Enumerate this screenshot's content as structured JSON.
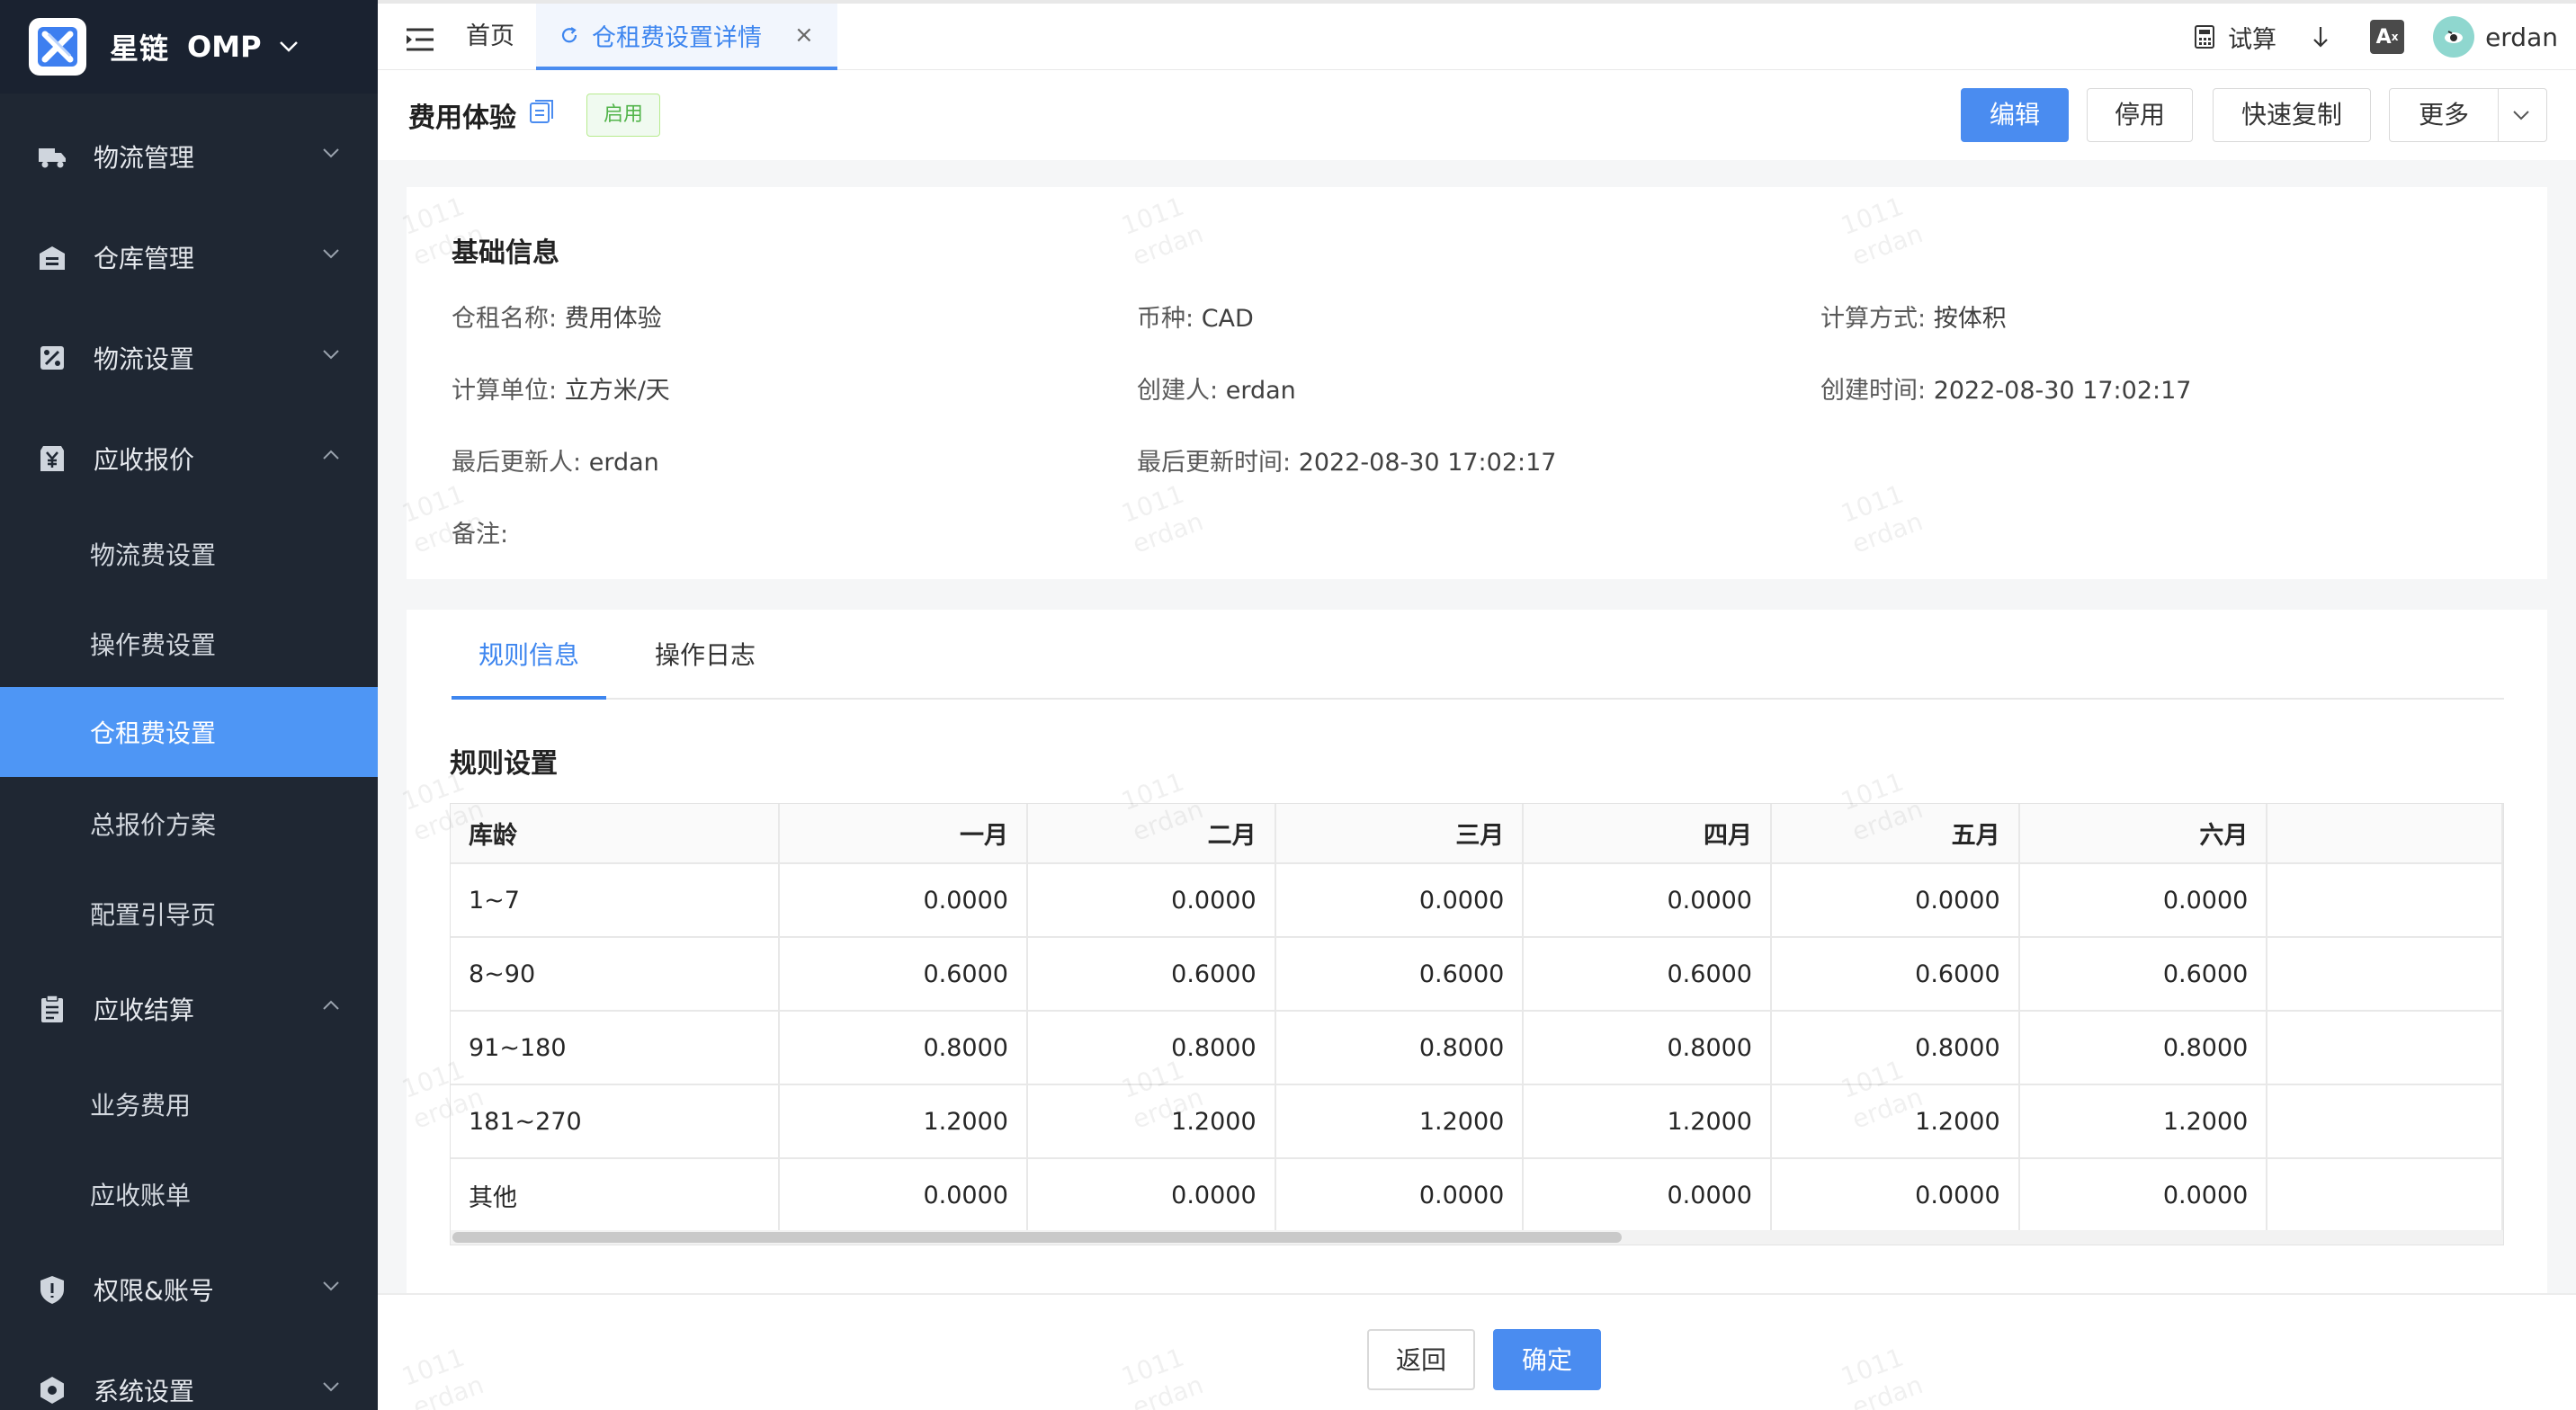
{
  "app": {
    "brand_name": "星链",
    "brand_product": "OMP"
  },
  "sidebar": {
    "items": [
      {
        "label": "物流管理",
        "icon": "truck-icon",
        "expanded": false
      },
      {
        "label": "仓库管理",
        "icon": "warehouse-icon",
        "expanded": false
      },
      {
        "label": "物流设置",
        "icon": "settings-box-icon",
        "expanded": false
      },
      {
        "label": "应收报价",
        "icon": "yen-icon",
        "expanded": true
      },
      {
        "label": "应收结算",
        "icon": "clipboard-icon",
        "expanded": true
      },
      {
        "label": "权限&账号",
        "icon": "shield-icon",
        "expanded": false
      },
      {
        "label": "系统设置",
        "icon": "hexagon-settings-icon",
        "expanded": false
      }
    ],
    "quote_children": [
      "物流费设置",
      "操作费设置",
      "仓租费设置",
      "总报价方案",
      "配置引导页"
    ],
    "settlement_children": [
      "业务费用",
      "应收账单"
    ],
    "active_child": "仓租费设置"
  },
  "topbar": {
    "home_tab": "首页",
    "active_tab": "仓租费设置详情",
    "close_symbol": "×",
    "trial_label": "试算",
    "lang_label": "A",
    "username": "erdan"
  },
  "header": {
    "title": "费用体验",
    "status": "启用",
    "buttons": {
      "edit": "编辑",
      "disable": "停用",
      "quick_copy": "快速复制",
      "more": "更多"
    }
  },
  "basic_info": {
    "section_title": "基础信息",
    "fields": {
      "name_label": "仓租名称:",
      "name_value": "费用体验",
      "currency_label": "币种:",
      "currency_value": "CAD",
      "calc_method_label": "计算方式:",
      "calc_method_value": "按体积",
      "calc_unit_label": "计算单位:",
      "calc_unit_value": "立方米/天",
      "creator_label": "创建人:",
      "creator_value": "erdan",
      "created_time_label": "创建时间:",
      "created_time_value": "2022-08-30 17:02:17",
      "updater_label": "最后更新人:",
      "updater_value": "erdan",
      "updated_time_label": "最后更新时间:",
      "updated_time_value": "2022-08-30 17:02:17",
      "remark_label": "备注:",
      "remark_value": ""
    }
  },
  "tabs": {
    "rules": "规则信息",
    "log": "操作日志",
    "active": "rules"
  },
  "rules": {
    "section_title": "规则设置",
    "columns": [
      "库龄",
      "一月",
      "二月",
      "三月",
      "四月",
      "五月",
      "六月"
    ],
    "rows": [
      [
        "1~7",
        "0.0000",
        "0.0000",
        "0.0000",
        "0.0000",
        "0.0000",
        "0.0000"
      ],
      [
        "8~90",
        "0.6000",
        "0.6000",
        "0.6000",
        "0.6000",
        "0.6000",
        "0.6000"
      ],
      [
        "91~180",
        "0.8000",
        "0.8000",
        "0.8000",
        "0.8000",
        "0.8000",
        "0.8000"
      ],
      [
        "181~270",
        "1.2000",
        "1.2000",
        "1.2000",
        "1.2000",
        "1.2000",
        "1.2000"
      ],
      [
        "其他",
        "0.0000",
        "0.0000",
        "0.0000",
        "0.0000",
        "0.0000",
        "0.0000"
      ]
    ]
  },
  "footer": {
    "back": "返回",
    "confirm": "确定"
  },
  "watermark": {
    "line1": "1011",
    "line2": "erdan"
  },
  "colors": {
    "sidebar_bg": "#1f2733",
    "accent": "#4a8cf0",
    "active_menu": "#4e96f5",
    "status_green": "#52b44a"
  }
}
